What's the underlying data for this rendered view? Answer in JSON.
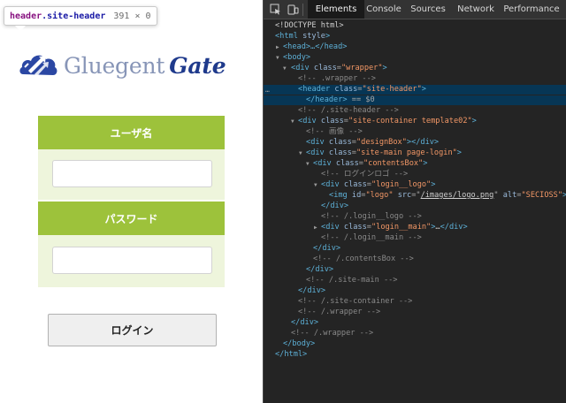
{
  "tooltip": {
    "tag": "header",
    "class_name": ".site-header",
    "size": "391 × 0"
  },
  "logo": {
    "text_part1": "Gluegent",
    "text_part2": "Gate"
  },
  "form": {
    "username_label": "ユーザ名",
    "password_label": "パスワード",
    "login_label": "ログイン"
  },
  "devtools": {
    "tabs": [
      "Elements",
      "Console",
      "Sources",
      "Network",
      "Performance"
    ],
    "active_tab": "Elements",
    "selected_suffix": "== $0",
    "tree": {
      "doctype": "<!DOCTYPE html>",
      "html_open": "<html",
      "html_attr": "style",
      "head": "<head>…</head>",
      "body_open": "<body>",
      "div": "div",
      "header": "header",
      "header_close": "</header>",
      "class_attr": "class",
      "id_attr": "id",
      "src_attr": "src",
      "alt_attr": "alt",
      "img": "img",
      "wrapper_val": "\"wrapper\"",
      "site_header_val": "\"site-header\"",
      "site_container_val": "\"site-container template02\"",
      "design_box_val": "\"designBox\"",
      "site_main_val": "\"site-main page-login\"",
      "contents_box_val": "\"contentsBox\"",
      "login_logo_val": "\"login__logo\"",
      "logo_id_val": "\"logo\"",
      "logo_src_val": "/images/logo.png",
      "logo_alt_val": "\"SECIOSS\"",
      "login_main_val": "\"login__main\"",
      "comment_wrapper": "<!-- .wrapper -->",
      "comment_site_header_end": "<!-- /.site-header -->",
      "comment_image": "<!-- 画像 -->",
      "comment_login_logo": "<!-- ログインロゴ -->",
      "comment_login_logo_end": "<!-- /.login__logo -->",
      "comment_login_main_end": "<!-- /.login__main -->",
      "comment_contents_box_end": "<!-- /.contentsBox -->",
      "comment_site_main_end": "<!-- /.site-main -->",
      "comment_site_container_end": "<!-- /.site-container -->",
      "comment_wrapper_end": "<!-- /.wrapper -->",
      "div_close": "</div>",
      "body_close": "</body>",
      "html_close": "</html>",
      "ellipsis": "…"
    }
  },
  "colors": {
    "brand_green": "#9dc23b",
    "form_bg": "#eef5dc",
    "logo_blue": "#1f3a8c",
    "logo_light": "#8795b7",
    "selection": "#073655"
  },
  "icons": [
    "inspect-element-icon",
    "device-toolbar-icon",
    "logo-mark"
  ]
}
